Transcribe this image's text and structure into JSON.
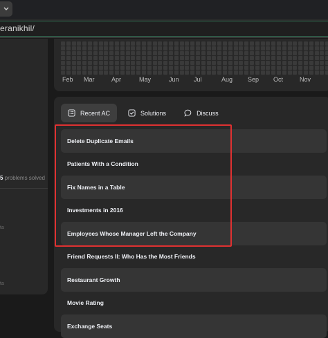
{
  "browser": {
    "url": "eranikhil/"
  },
  "profile": {
    "solved_number": "5",
    "solved_suffix": " problems solved",
    "small_marks": [
      "ta",
      "ta"
    ]
  },
  "heatmap": {
    "months": [
      "Feb",
      "Mar",
      "Apr",
      "May",
      "Jun",
      "Jul",
      "Aug",
      "Sep",
      "Oct",
      "Nov"
    ]
  },
  "tabs": [
    {
      "label": "Recent AC",
      "icon": "checklist-icon",
      "active": true
    },
    {
      "label": "Solutions",
      "icon": "check-square-icon",
      "active": false
    },
    {
      "label": "Discuss",
      "icon": "chat-bubble-icon",
      "active": false
    }
  ],
  "recent_ac": [
    "Delete Duplicate Emails",
    "Patients With a Condition",
    "Fix Names in a Table",
    "Investments in 2016",
    "Employees Whose Manager Left the Company",
    "Friend Requests II: Who Has the Most Friends",
    "Restaurant Growth",
    "Movie Rating",
    "Exchange Seats"
  ],
  "colors": {
    "highlight": "#e03131",
    "page_bg": "#1a1a1a",
    "card_bg": "#282828",
    "row_shade": "#353535"
  }
}
